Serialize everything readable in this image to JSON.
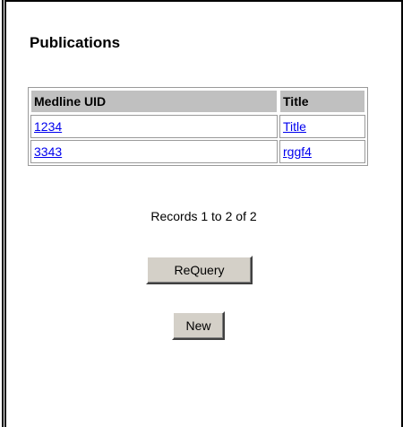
{
  "page": {
    "heading": "Publications"
  },
  "table": {
    "headers": [
      "Medline UID",
      "Title"
    ],
    "rows": [
      {
        "uid": "1234",
        "title": "Title"
      },
      {
        "uid": "3343",
        "title": "rggf4"
      }
    ]
  },
  "pagination": {
    "records_text": "Records 1 to 2 of 2"
  },
  "buttons": {
    "requery_label": "ReQuery",
    "new_label": "New"
  },
  "colors": {
    "header_bg": "#c0c0c0",
    "link": "#0000ee",
    "button_face": "#d4d0c8"
  }
}
